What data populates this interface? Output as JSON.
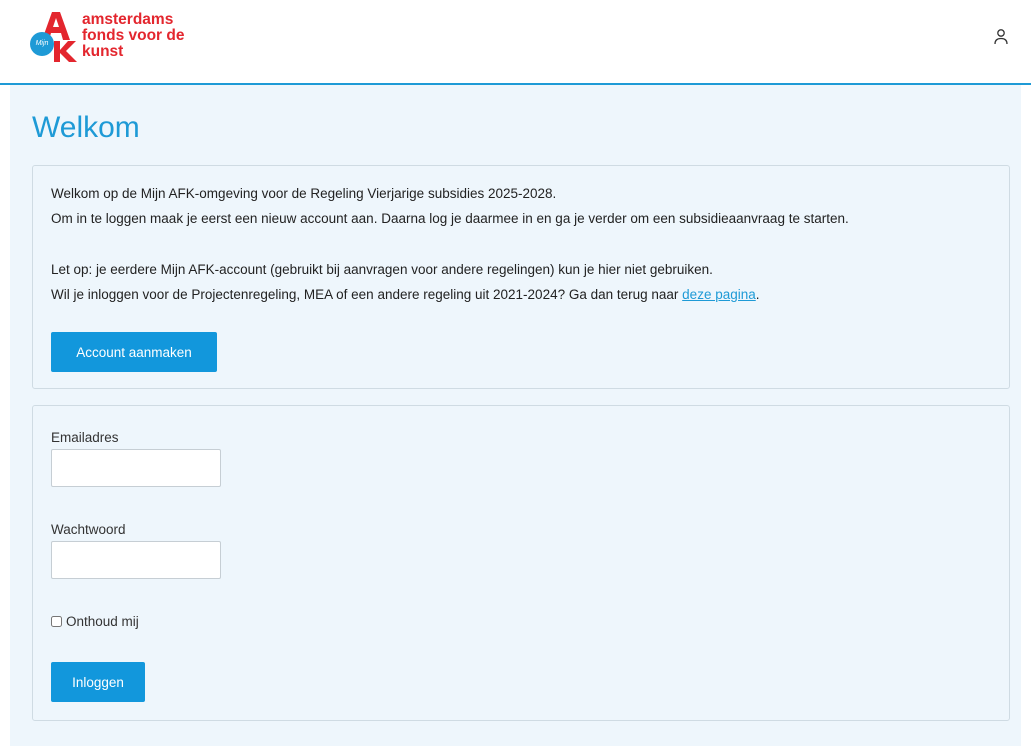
{
  "header": {
    "logo": {
      "badge": "Mijn",
      "lines": [
        "amsterdams",
        "fonds voor de",
        "kunst"
      ]
    },
    "user_icon": "user-icon"
  },
  "main": {
    "title": "Welkom",
    "intro": {
      "line1": "Welkom op de Mijn AFK-omgeving voor de Regeling Vierjarige subsidies 2025-2028.",
      "line2": "Om in te loggen maak je eerst een nieuw account aan. Daarna log je daarmee in en ga je verder om een subsidieaanvraag te starten.",
      "line3": "Let op: je eerdere Mijn AFK-account (gebruikt bij aanvragen voor andere regelingen) kun je hier niet gebruiken.",
      "line4_prefix": "Wil je inloggen voor de Projectenregeling, MEA of een andere regeling uit 2021-2024? Ga dan terug naar ",
      "line4_link": "deze pagina",
      "line4_suffix": ".",
      "account_button": "Account aanmaken"
    },
    "login": {
      "email_label": "Emailadres",
      "email_value": "",
      "password_label": "Wachtwoord",
      "password_value": "",
      "remember_label": "Onthoud mij",
      "login_button": "Inloggen"
    }
  },
  "colors": {
    "brand_red": "#e3262e",
    "brand_blue": "#1e9ad6",
    "button_blue": "#1297dc",
    "content_bg": "#eef6fc"
  }
}
